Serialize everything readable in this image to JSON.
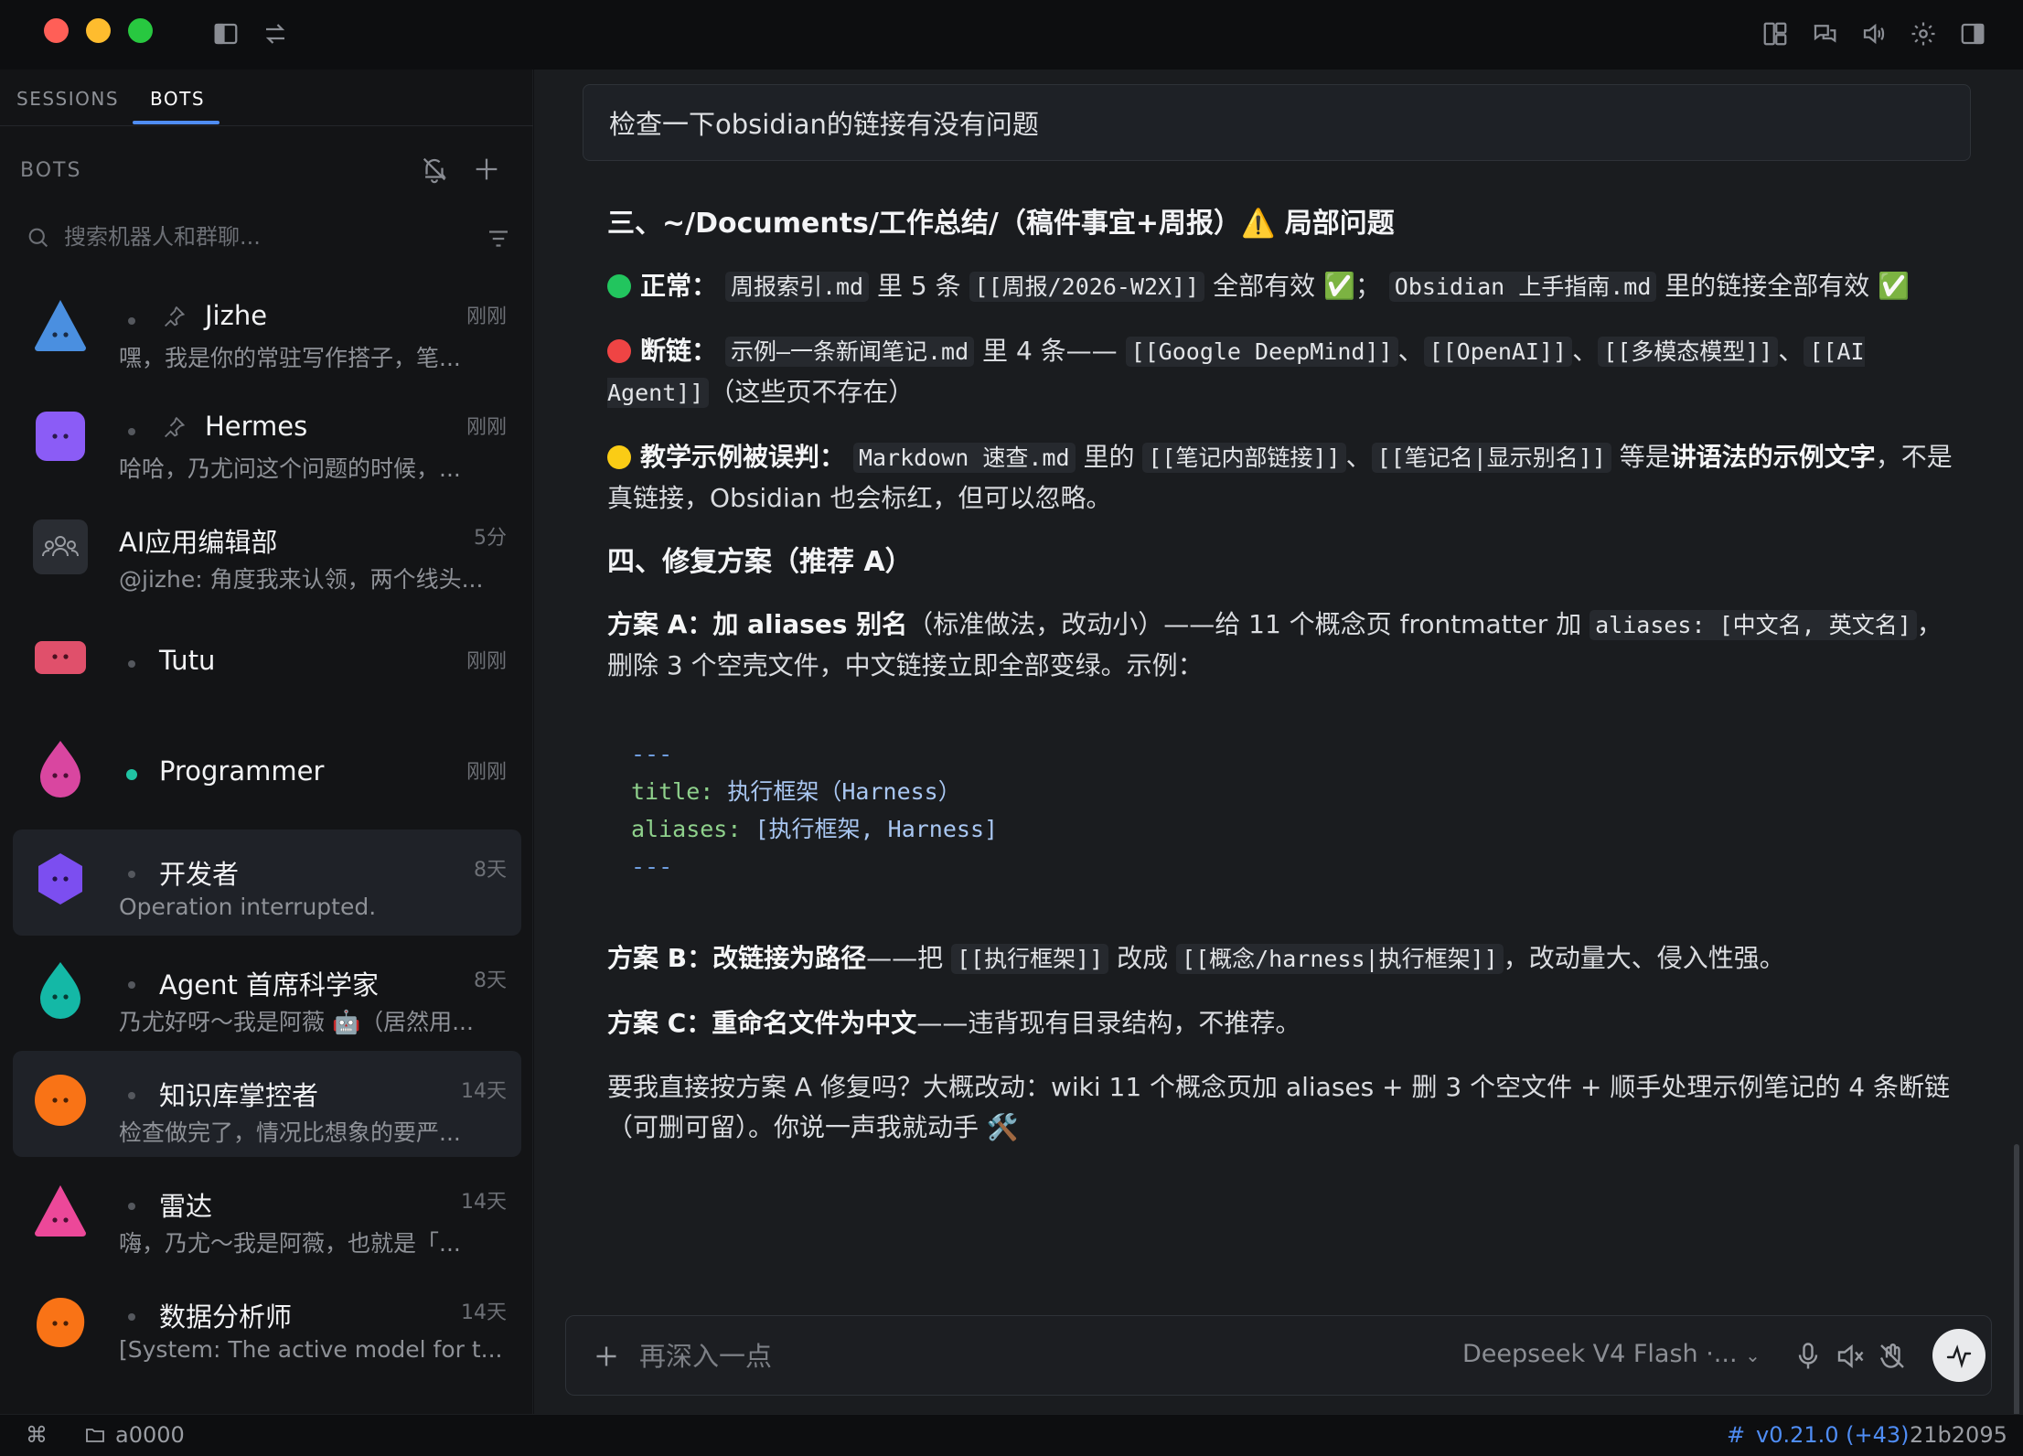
{
  "window": {
    "colors": {
      "close": "#ff5f57",
      "minimize": "#febc2e",
      "zoom": "#28c840"
    }
  },
  "sidebar": {
    "tabs": [
      {
        "label": "SESSIONS",
        "active": false
      },
      {
        "label": "BOTS",
        "active": true
      }
    ],
    "section_title": "BOTS",
    "search_placeholder": "搜索机器人和群聊...",
    "bots": [
      {
        "name": "Jizhe",
        "time": "刚刚",
        "preview": "嘿，我是你的常驻写作搭子，笔...",
        "pinned": true,
        "avatar": "blue-triangle",
        "color": "#4a8fe0"
      },
      {
        "name": "Hermes",
        "time": "刚刚",
        "preview": "哈哈，乃尤问这个问题的时候，...",
        "pinned": true,
        "avatar": "purple-square",
        "color": "#8b5cf6"
      },
      {
        "name": "AI应用编辑部",
        "time": "5分",
        "preview": "@jizhe: 角度我来认领，两个线头...",
        "pinned": false,
        "avatar": "group",
        "color": "#2a2d33"
      },
      {
        "name": "Tutu",
        "time": "刚刚",
        "preview": "",
        "pinned": false,
        "avatar": "red-rectangle",
        "color": "#e0506b"
      },
      {
        "name": "Programmer",
        "time": "刚刚",
        "preview": "",
        "pinned": false,
        "avatar": "pink-drop",
        "color": "#d946a0",
        "online": true
      },
      {
        "name": "开发者",
        "time": "8天",
        "preview": "Operation interrupted.",
        "pinned": false,
        "avatar": "purple-hexagon",
        "color": "#7c4ef0",
        "selected": true
      },
      {
        "name": "Agent 首席科学家",
        "time": "8天",
        "preview": "乃尤好呀～我是阿薇 🤖（居然用...",
        "pinned": false,
        "avatar": "teal-drop",
        "color": "#14b8a6"
      },
      {
        "name": "知识库掌控者",
        "time": "14天",
        "preview": "检查做完了，情况比想象的要严...",
        "pinned": false,
        "avatar": "orange-circle",
        "color": "#f97316",
        "selected": true
      },
      {
        "name": "雷达",
        "time": "14天",
        "preview": "嗨，乃尤～我是阿薇，也就是「...",
        "pinned": false,
        "avatar": "pink-triangle",
        "color": "#ec4899"
      },
      {
        "name": "数据分析师",
        "time": "14天",
        "preview": "[System: The active model for t...",
        "pinned": false,
        "avatar": "orange-blob",
        "color": "#f97316"
      }
    ]
  },
  "chat": {
    "user_message": "检查一下obsidian的链接有没有问题",
    "section3_title": "三、~/Documents/工作总结/（稿件事宜+周报）⚠️ 局部问题",
    "normal": {
      "label": "正常",
      "code1": "周报索引.md",
      "text1": " 里 5 条 ",
      "code2": "[[周报/2026-W2X]]",
      "text2": " 全部有效 ✅；",
      "code3": "Obsidian 上手指南.md",
      "text3": " 里的链接全部有效 ✅"
    },
    "broken": {
      "label": "断链",
      "code1": "示例—一条新闻笔记.md",
      "text1": " 里 4 条—— ",
      "code2": "[[Google DeepMind]]",
      "code3": "[[OpenAI]]",
      "code4": "[[多模态模型]]",
      "code5": "[[AI Agent]]",
      "sep": "、",
      "text2": "（这些页不存在）"
    },
    "misread": {
      "label": "教学示例被误判",
      "code1": "Markdown 速查.md",
      "text1": " 里的 ",
      "code2": "[[笔记内部链接]]",
      "sep": "、",
      "code3": "[[笔记名|显示别名]]",
      "text2": " 等是",
      "bold": "讲语法的示例文字",
      "text3": "，不是真链接，Obsidian 也会标红，但可以忽略。"
    },
    "section4_title": "四、修复方案（推荐 A）",
    "plan_a": {
      "label": "方案 A：加 aliases 别名",
      "text1": "（标准做法，改动小）——给 11 个概念页 frontmatter 加 ",
      "code1": "aliases: [中文名, 英文名]",
      "text2": "，删除 3 个空壳文件，中文链接立即全部变绿。示例："
    },
    "code_block": {
      "dash": "---",
      "title_key": "title:",
      "title_val": "执行框架（Harness）",
      "aliases_key": "aliases:",
      "aliases_val": "[执行框架, Harness]"
    },
    "plan_b": {
      "label": "方案 B：改链接为路径",
      "text1": "——把 ",
      "code1": "[[执行框架]]",
      "text2": " 改成 ",
      "code2": "[[概念/harness|执行框架]]",
      "text3": "，改动量大、侵入性强。"
    },
    "plan_c": {
      "label": "方案 C：重命名文件为中文",
      "text1": "——违背现有目录结构，不推荐。"
    },
    "closing": "要我直接按方案 A 修复吗？大概改动：wiki 11 个概念页加 aliases + 删 3 个空文件 + 顺手处理示例笔记的 4 条断链（可删可留）。你说一声我就动手 🛠️",
    "composer_placeholder": "再深入一点",
    "model_label": "Deepseek V4 Flash ·..."
  },
  "statusbar": {
    "folder": "a0000",
    "version": "v0.21.0 (+43)",
    "commit": "21b2095",
    "version_color": "#4f8df5"
  }
}
